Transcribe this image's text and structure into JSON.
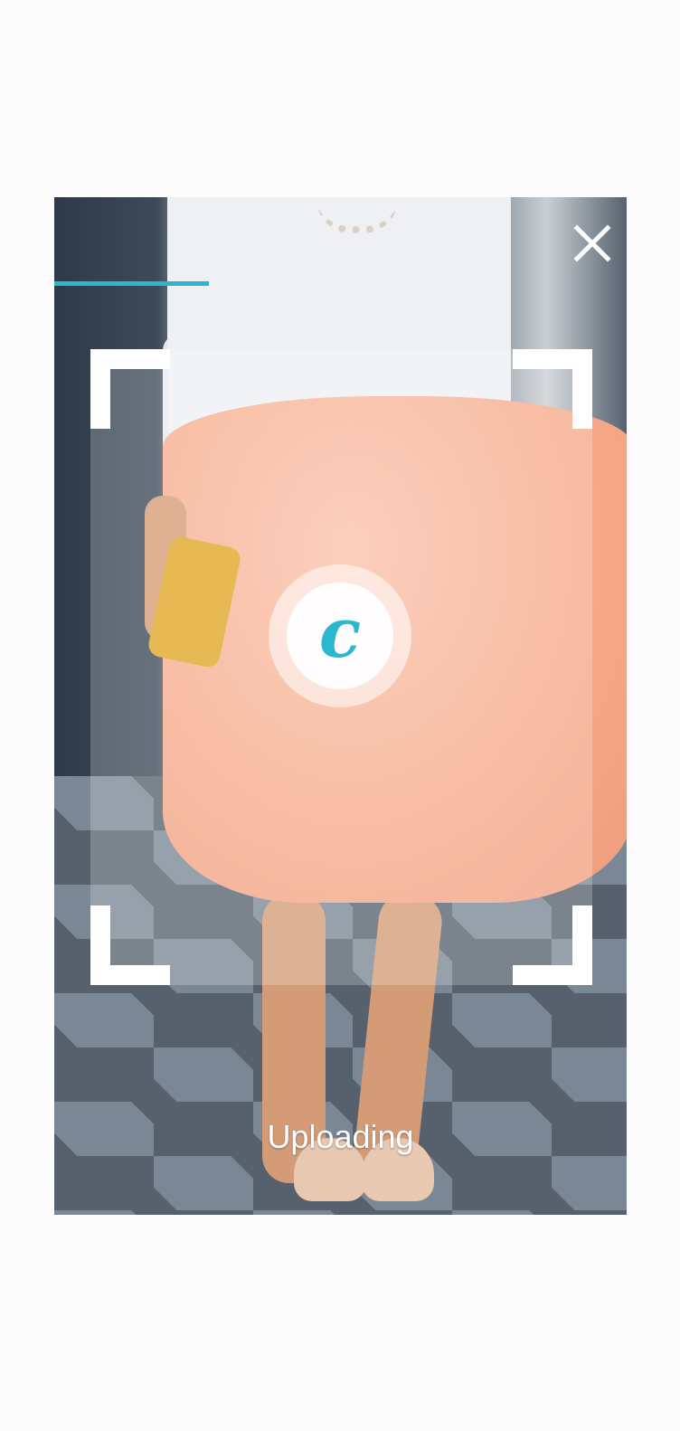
{
  "progress": {
    "value_percent": 27,
    "color": "#2bb7cd"
  },
  "close_button": {
    "icon": "close-icon"
  },
  "logo": {
    "letter": "c",
    "color": "#2bb7cd"
  },
  "status": {
    "text": "Uploading"
  },
  "photo": {
    "icon": "fashion-photo"
  }
}
